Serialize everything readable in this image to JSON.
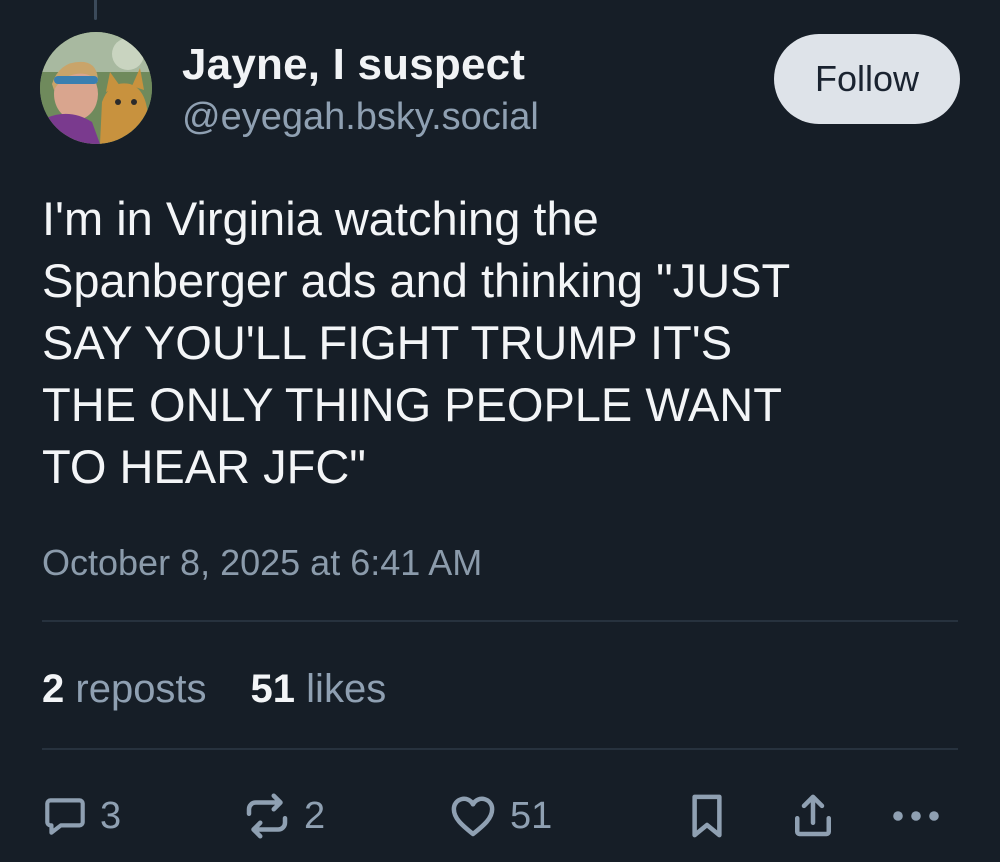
{
  "post": {
    "author": {
      "display_name": "Jayne, I suspect",
      "handle": "@eyegah.bsky.social"
    },
    "follow_label": "Follow",
    "text": "I'm in Virginia watching the\nSpanberger ads and thinking \"JUST\nSAY YOU'LL FIGHT TRUMP IT'S\nTHE ONLY THING PEOPLE WANT\nTO HEAR JFC\"",
    "timestamp": "October 8, 2025 at 6:41 AM",
    "stats": {
      "reposts_count": "2",
      "reposts_label": "reposts",
      "likes_count": "51",
      "likes_label": "likes"
    },
    "actions": {
      "reply_count": "3",
      "repost_count": "2",
      "like_count": "51"
    }
  },
  "icons": [
    "reply-icon",
    "repost-icon",
    "heart-icon",
    "bookmark-icon",
    "share-icon",
    "more-icon"
  ],
  "colors": {
    "background": "#161e27",
    "text": "#f1f3f5",
    "muted": "#8fa0b2",
    "follow_button_bg": "#dee3e9"
  }
}
